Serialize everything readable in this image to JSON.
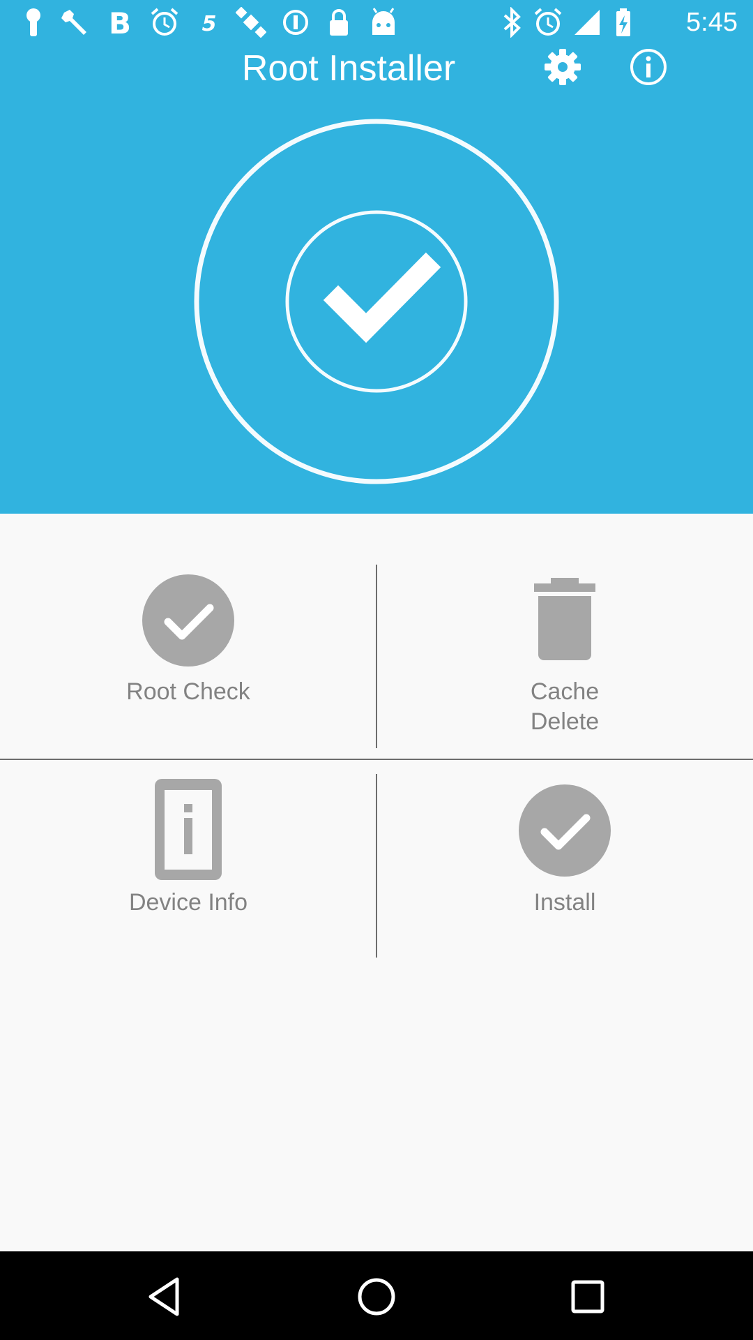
{
  "status_bar": {
    "time": "5:45",
    "left_icons": [
      "keyhole-icon",
      "wrench-icon",
      "bold-b-icon",
      "alarm-icon",
      "five-icon",
      "satellite-fake-gps-icon",
      "info-circle-icon",
      "lock-icon",
      "android-icon"
    ],
    "right_icons": [
      "bluetooth-icon",
      "alarm-icon",
      "signal-icon",
      "battery-charging-icon"
    ]
  },
  "toolbar": {
    "title": "Root Installer",
    "settings_icon": "gear-icon",
    "info_icon": "info-icon"
  },
  "hero": {
    "icon": "checkmark-circle-icon"
  },
  "actions": [
    {
      "label": "Root Check",
      "icon": "check-circle-icon"
    },
    {
      "label": "Cache\nDelete",
      "icon": "trash-icon"
    },
    {
      "label": "Device Info",
      "icon": "device-info-icon"
    },
    {
      "label": "Install",
      "icon": "check-circle-icon"
    }
  ],
  "colors": {
    "accent": "#31b3df",
    "icon_gray": "#a7a7a7",
    "label_gray": "#828282",
    "background": "#f9f9f9"
  },
  "nav_bar": {
    "icons": [
      "back-icon",
      "home-icon",
      "recents-icon"
    ]
  }
}
